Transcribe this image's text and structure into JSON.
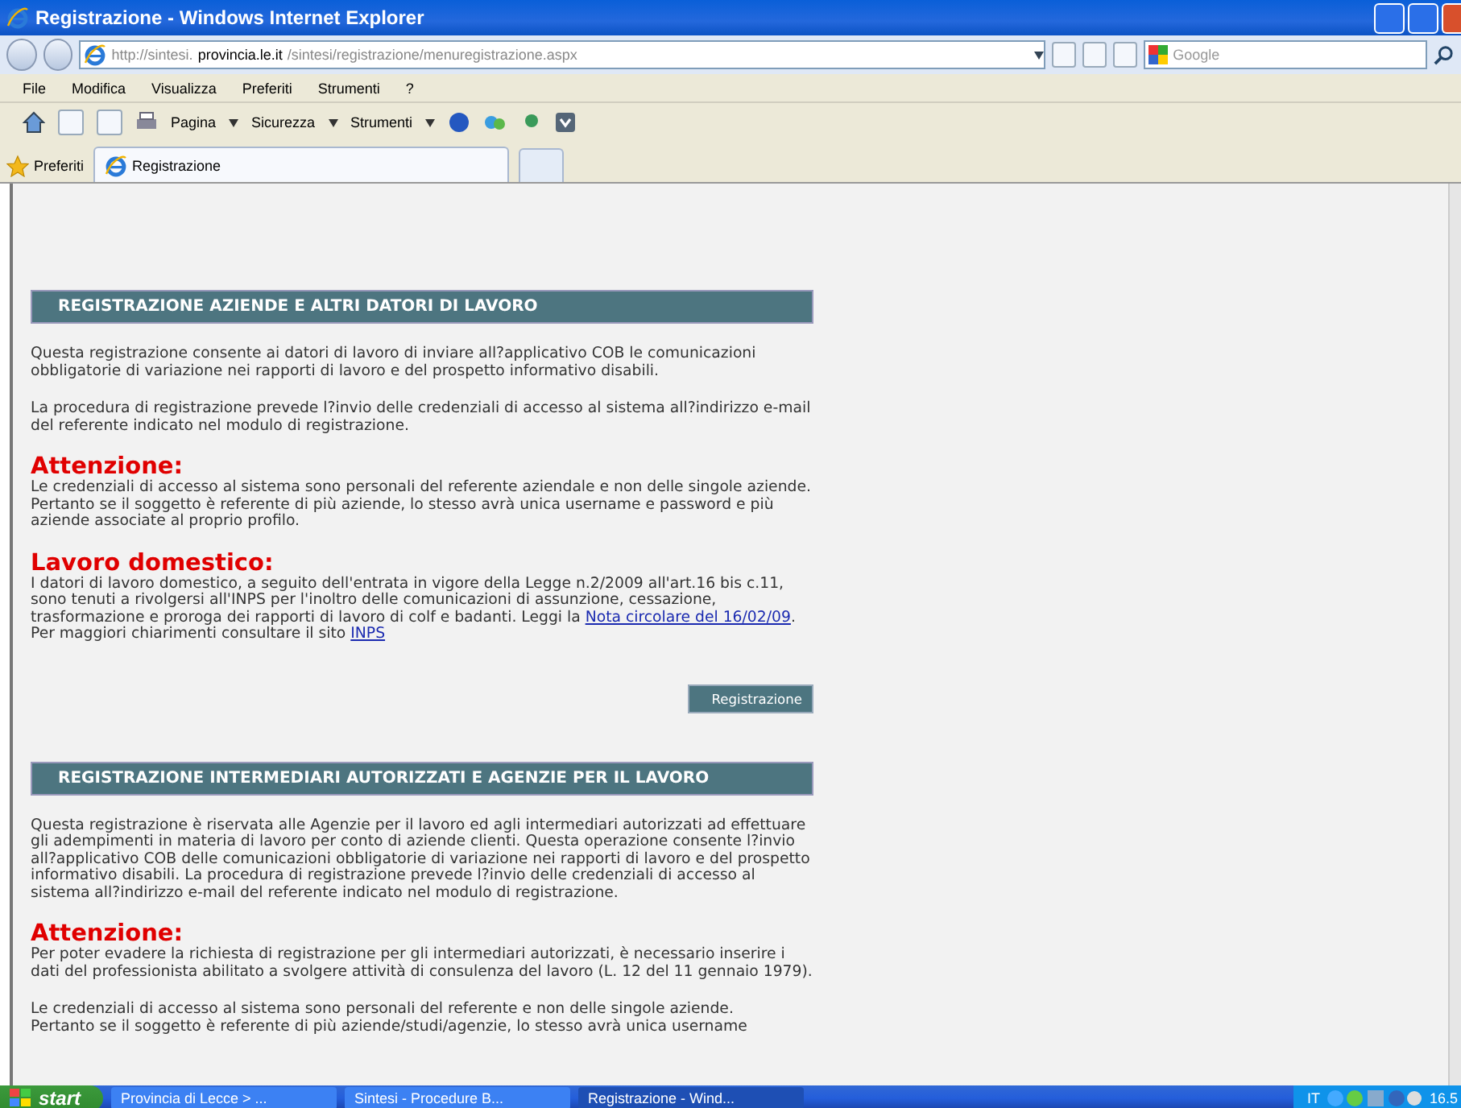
{
  "window": {
    "title": "Registrazione - Windows Internet Explorer"
  },
  "address_bar": {
    "url_parts": [
      {
        "text": "http://sintesi.",
        "strong": false
      },
      {
        "text": "provincia.le.it",
        "strong": true
      },
      {
        "text": "/sintesi/registrazione/menuregistrazione.aspx",
        "strong": false
      }
    ],
    "search_placeholder": "Google"
  },
  "menu": [
    "File",
    "Modifica",
    "Visualizza",
    "Preferiti",
    "Strumenti",
    "?"
  ],
  "command_bar": [
    "Pagina",
    "Sicurezza",
    "Strumenti"
  ],
  "favorites": "Preferiti",
  "tabs": [
    {
      "label": "Registrazione",
      "selected": true
    }
  ],
  "sections": [
    {
      "heading": "REGISTRAZIONE AZIENDE E ALTRI DATORI DI LAVORO",
      "blocks": [
        {
          "kind": "text",
          "parts": [
            {
              "text": "Questa registrazione consente ai datori di lavoro di inviare all?applicativo COB le comunicazioni obbligatorie di variazione nei rapporti di lavoro e del prospetto informativo disabili."
            }
          ]
        },
        {
          "kind": "text",
          "parts": [
            {
              "text": "La procedura di registrazione prevede l?invio delle credenziali di accesso al sistema all?indirizzo e-mail del referente indicato nel modulo di registrazione."
            }
          ]
        },
        {
          "kind": "heading",
          "parts": [
            {
              "text": "Attenzione:"
            }
          ]
        },
        {
          "kind": "text",
          "parts": [
            {
              "text": "Le credenziali di accesso al sistema sono personali del referente aziendale e non delle singole aziende. Pertanto se il soggetto è referente di più aziende, lo stesso avrà unica username e password e più aziende associate al proprio profilo."
            }
          ]
        },
        {
          "kind": "heading",
          "parts": [
            {
              "text": "Lavoro domestico:"
            }
          ]
        },
        {
          "kind": "line",
          "parts": [
            {
              "text": "I datori di lavoro domestico, a seguito dell'entrata in vigore della Legge n.2/2009 all'art.16 bis c.11, sono tenuti a rivolgersi all'INPS per l'inoltro delle comunicazioni di assunzione, cessazione, trasformazione e proroga dei rapporti di lavoro di colf e badanti. Leggi la "
            },
            {
              "text": "Nota circolare del 16/02/09",
              "link": true
            },
            {
              "text": "."
            }
          ]
        },
        {
          "kind": "line",
          "parts": [
            {
              "text": "Per maggiori chiarimenti consultare il sito "
            },
            {
              "text": "INPS",
              "link": true
            }
          ]
        }
      ],
      "button": "Registrazione"
    },
    {
      "heading": "REGISTRAZIONE INTERMEDIARI AUTORIZZATI E AGENZIE PER IL LAVORO",
      "blocks": [
        {
          "kind": "text",
          "parts": [
            {
              "text": "Questa registrazione è riservata alle Agenzie per il lavoro ed agli intermediari autorizzati ad effettuare gli adempimenti in materia di lavoro per conto di aziende clienti. Questa operazione consente l?invio all?applicativo COB delle comunicazioni obbligatorie di variazione nei rapporti di lavoro e del prospetto informativo disabili. La procedura di registrazione prevede l?invio delle credenziali di accesso al sistema all?indirizzo e-mail del referente indicato nel modulo di registrazione."
            }
          ]
        },
        {
          "kind": "heading",
          "parts": [
            {
              "text": "Attenzione:"
            }
          ]
        },
        {
          "kind": "text",
          "parts": [
            {
              "text": "Per poter evadere la richiesta di registrazione per gli intermediari autorizzati, è necessario inserire i dati del professionista abilitato a svolgere attività di consulenza del lavoro (L. 12 del 11 gennaio 1979)."
            }
          ]
        },
        {
          "kind": "line",
          "parts": [
            {
              "text": "Le credenziali di accesso al sistema sono personali del referente e non delle singole aziende."
            }
          ]
        },
        {
          "kind": "line",
          "parts": [
            {
              "text": "Pertanto se il soggetto è referente di più aziende/studi/agenzie, lo stesso avrà unica username"
            }
          ]
        }
      ]
    }
  ],
  "taskbar": {
    "start": "start",
    "tasks": [
      {
        "label": "Provincia di Lecce > ...",
        "selected": false
      },
      {
        "label": "Sintesi - Procedure B...",
        "selected": false
      },
      {
        "label": "Registrazione - Wind...",
        "selected": true
      }
    ],
    "language": "IT",
    "clock": "16.5"
  }
}
